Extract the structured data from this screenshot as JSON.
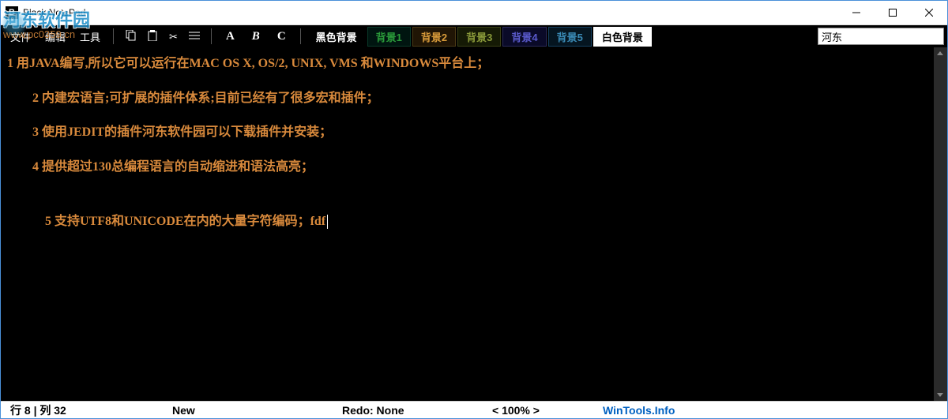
{
  "window": {
    "title": "Black NotePad",
    "icon_letter": "B"
  },
  "menu": {
    "file": "文件",
    "edit": "编辑",
    "tools": "工具"
  },
  "toolbar": {
    "font_a": "A",
    "font_b": "B",
    "font_c": "C",
    "bg_black": "黑色背景",
    "bg1": "背景1",
    "bg2": "背景2",
    "bg3": "背景3",
    "bg4": "背景4",
    "bg5": "背景5",
    "bg_white": "白色背景"
  },
  "search": {
    "value": "河东"
  },
  "editor": {
    "lines": [
      "1 用JAVA编写,所以它可以运行在MAC OS X, OS/2, UNIX, VMS 和WINDOWS平台上；",
      "2 内建宏语言;可扩展的插件体系;目前已经有了很多宏和插件；",
      "3 使用JEDIT的插件河东软件园可以下载插件并安装；",
      "4 提供超过130总编程语言的自动缩进和语法高亮；",
      "5 支持UTF8和UNICODE在内的大量字符编码；fdf"
    ]
  },
  "status": {
    "position": "行 8 | 列 32",
    "file_state": "New",
    "redo": "Redo: None",
    "zoom": "< 100% >",
    "link": "WinTools.Info"
  },
  "watermark": {
    "text": "河东软件园",
    "url": "www.pc0359.cn"
  },
  "icons": {
    "copy": "⎘",
    "paste": "📋",
    "cut": "✂",
    "list": "≡"
  }
}
